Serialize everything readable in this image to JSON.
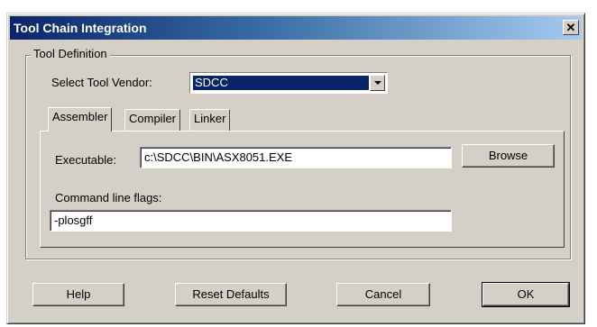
{
  "window": {
    "title": "Tool Chain Integration",
    "close_glyph": "✕"
  },
  "tool_definition": {
    "legend": "Tool Definition",
    "vendor_label": "Select Tool Vendor:",
    "vendor_value": "SDCC"
  },
  "tabs": [
    {
      "label": "Assembler",
      "active": true
    },
    {
      "label": "Compiler",
      "active": false
    },
    {
      "label": "Linker",
      "active": false
    }
  ],
  "assembler": {
    "executable_label": "Executable:",
    "executable_value": "c:\\SDCC\\BIN\\ASX8051.EXE",
    "browse_label": "Browse",
    "flags_label": "Command line flags:",
    "flags_value": "-plosgff"
  },
  "buttons": {
    "help": "Help",
    "reset": "Reset Defaults",
    "cancel": "Cancel",
    "ok": "OK"
  },
  "colors": {
    "titlebar_start": "#0a246a",
    "titlebar_end": "#a6caf0",
    "face": "#d4d0c8",
    "selection": "#0a246a"
  }
}
